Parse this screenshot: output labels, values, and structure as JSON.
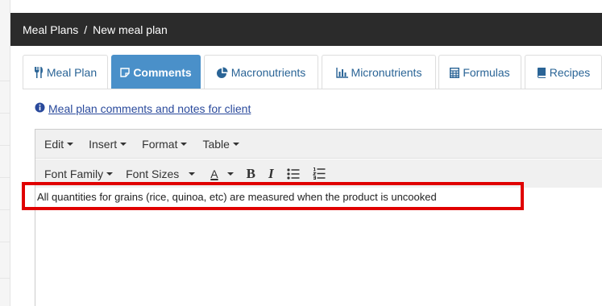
{
  "breadcrumb": {
    "parent": "Meal Plans",
    "separator": "/",
    "current": "New meal plan"
  },
  "tabs": [
    {
      "label": "Meal Plan",
      "icon": "cutlery-icon",
      "active": false
    },
    {
      "label": "Comments",
      "icon": "note-icon",
      "active": true
    },
    {
      "label": "Macronutrients",
      "icon": "pie-chart-icon",
      "active": false
    },
    {
      "label": "Micronutrients",
      "icon": "bar-chart-icon",
      "active": false
    },
    {
      "label": "Formulas",
      "icon": "calculator-icon",
      "active": false
    },
    {
      "label": "Recipes",
      "icon": "book-icon",
      "active": false
    }
  ],
  "info": {
    "icon": "info-circle-icon",
    "text": "Meal plan comments and notes for client"
  },
  "editor": {
    "menus": [
      "Edit",
      "Insert",
      "Format",
      "Table"
    ],
    "toolbar": {
      "font_family": "Font Family",
      "font_sizes": "Font Sizes",
      "text_color": "A",
      "bold": "B",
      "italic": "I",
      "bullet_list_icon": "bullet-list-icon",
      "numbered_list_icon": "numbered-list-icon"
    },
    "content": "All quantities for grains (rice, quinoa, etc) are measured when the product is uncooked"
  },
  "colors": {
    "header_bg": "#2b2b2b",
    "active_tab": "#4a90c9",
    "link": "#2a6496",
    "highlight": "#e00000"
  }
}
